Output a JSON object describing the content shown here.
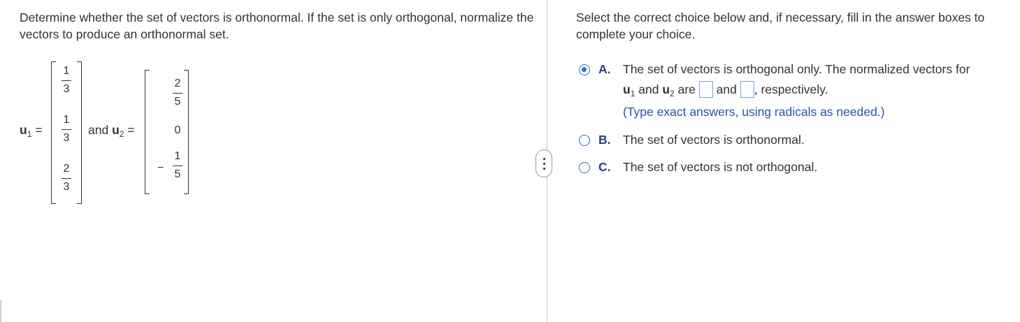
{
  "left": {
    "instruction": "Determine whether the set of vectors is orthonormal. If the set is only orthogonal, normalize the vectors to produce an orthonormal set.",
    "u1_name": "u",
    "u1_sub": "1",
    "equals": "=",
    "and_text": "and",
    "u2_name": "u",
    "u2_sub": "2",
    "u1_entries": [
      {
        "num": "1",
        "den": "3"
      },
      {
        "num": "1",
        "den": "3"
      },
      {
        "num": "2",
        "den": "3"
      }
    ],
    "u2_entries": [
      {
        "num": "2",
        "den": "5"
      },
      {
        "value": "0"
      },
      {
        "sign": "−",
        "num": "1",
        "den": "5"
      }
    ]
  },
  "right": {
    "instruction": "Select the correct choice below and, if necessary, fill in the answer boxes to complete your choice.",
    "choices": [
      {
        "letter": "A.",
        "line1": "The set of vectors is orthogonal only. The normalized vectors for",
        "line2_u": "u",
        "line2_sub1": "1",
        "line2_and": "and",
        "line2_sub2": "2",
        "line2_are": "are",
        "line2_and2": "and",
        "line2_end": ", respectively.",
        "hint": "(Type exact answers, using radicals as needed.)",
        "selected": true
      },
      {
        "letter": "B.",
        "text": "The set of vectors is orthonormal.",
        "selected": false
      },
      {
        "letter": "C.",
        "text": "The set of vectors is not orthogonal.",
        "selected": false
      }
    ]
  },
  "colors": {
    "accent": "#2c6fd1",
    "letter": "#2a3f88",
    "hint": "#2b52a3",
    "text": "#333333"
  },
  "icons": {
    "splitter": "vertical-ellipsis-icon"
  }
}
